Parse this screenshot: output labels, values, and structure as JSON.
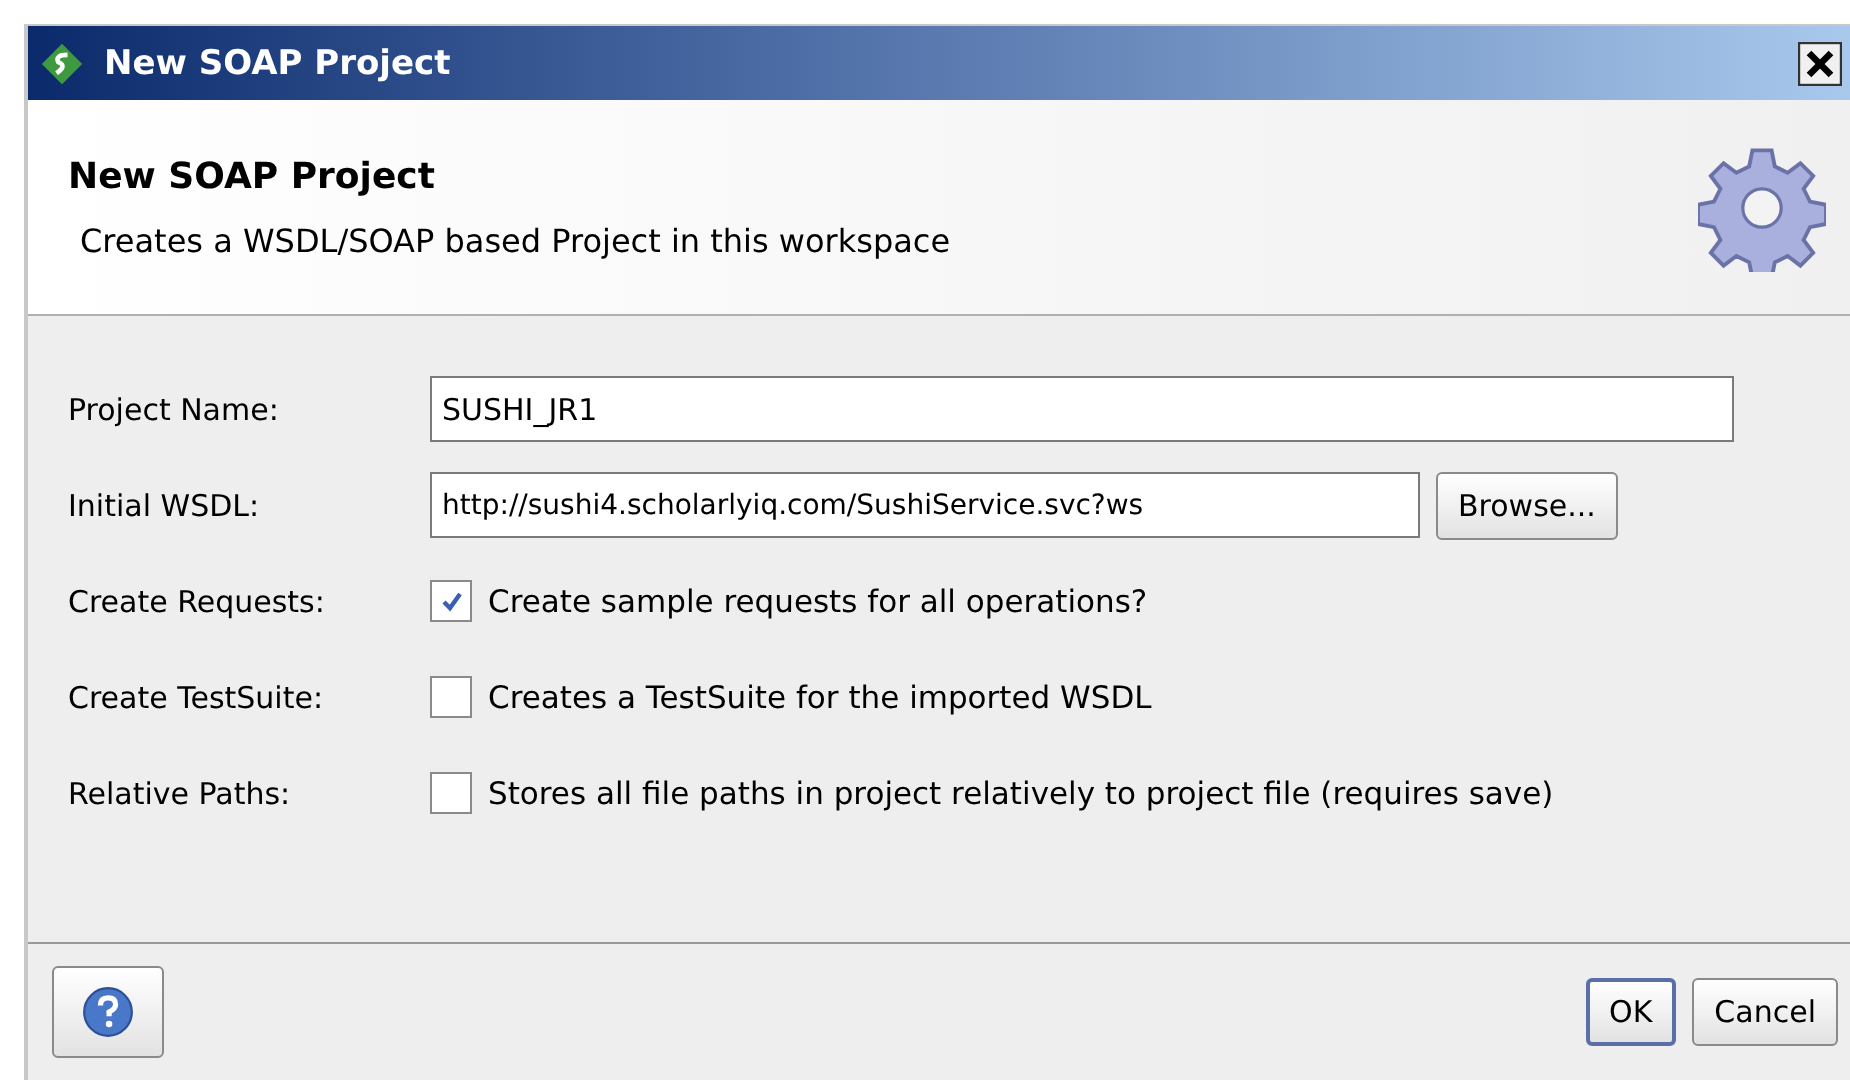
{
  "window": {
    "title": "New SOAP Project"
  },
  "header": {
    "title": "New SOAP Project",
    "subtitle": "Creates a WSDL/SOAP based Project in this workspace"
  },
  "fields": [
    {
      "kind": "text",
      "label": "Project Name:",
      "value": "SUSHI_JR1"
    },
    {
      "kind": "browse",
      "label": "Initial WSDL:",
      "value": "http://sushi4.scholarlyiq.com/SushiService.svc?ws",
      "button": "Browse..."
    },
    {
      "kind": "checkbox",
      "label": "Create Requests:",
      "checked": true,
      "text": "Create sample requests for all operations?"
    },
    {
      "kind": "checkbox",
      "label": "Create TestSuite:",
      "checked": false,
      "text": "Creates a TestSuite for the imported WSDL"
    },
    {
      "kind": "checkbox",
      "label": "Relative Paths:",
      "checked": false,
      "text": "Stores all file paths in project relatively to project file (requires save)"
    }
  ],
  "buttons": [
    {
      "label": "OK",
      "selected": true
    },
    {
      "label": "Cancel",
      "selected": false
    }
  ]
}
